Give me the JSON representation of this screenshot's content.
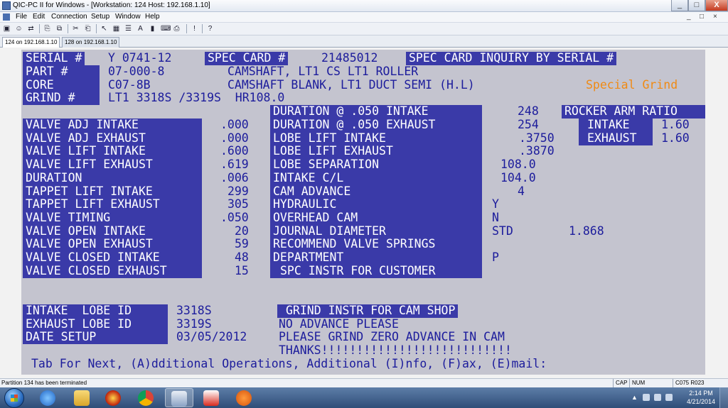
{
  "window": {
    "title": "QIC-PC II for Windows - [Workstation: 124  Host: 192.168.1.10]",
    "min_label": "_",
    "max_label": "□",
    "close_label": "X"
  },
  "menu": {
    "items": [
      "File",
      "Edit",
      "Connection",
      "Setup",
      "Window",
      "Help"
    ],
    "inner_controls": [
      "_",
      "□",
      "×"
    ]
  },
  "toolbar": {
    "buttons": [
      "save-icon",
      "user-icon",
      "connect-icon",
      "copy-icon",
      "paste-icon",
      "cut-icon",
      "select-icon",
      "grid-icon",
      "font-icon",
      "color-icon",
      "print-icon",
      "pause-icon",
      "help-icon"
    ]
  },
  "tabs": [
    {
      "label": "124 on 192.168.1.10",
      "active": true
    },
    {
      "label": "128 on 192.168.1.10",
      "active": false
    }
  ],
  "screen": {
    "serial_label": "SERIAL #",
    "serial_value": "Y 0741-12",
    "spec_card_label": "SPEC CARD #",
    "spec_card_value": "21485012",
    "inquiry_title": "SPEC CARD INQUIRY BY SERIAL #",
    "part_label": "PART #",
    "part_value": "07-000-8",
    "part_desc": "CAMSHAFT, LT1 CS LT1 ROLLER",
    "core_label": "CORE",
    "core_value": "C07-8B",
    "core_desc": "CAMSHAFT BLANK, LT1 DUCT SEMI (H.L)",
    "special": "Special Grind",
    "grind_label": "GRIND #",
    "grind_value": "LT1 3318S /3319S  HR108.0",
    "left_fields": [
      {
        "label": "VALVE ADJ INTAKE",
        "value": ".000"
      },
      {
        "label": "VALVE ADJ EXHAUST",
        "value": ".000"
      },
      {
        "label": "VALVE LIFT INTAKE",
        "value": ".600"
      },
      {
        "label": "VALVE LIFT EXHAUST",
        "value": ".619"
      },
      {
        "label": "DURATION",
        "value": ".006"
      },
      {
        "label": "TAPPET LIFT INTAKE",
        "value": "299"
      },
      {
        "label": "TAPPET LIFT EXHAUST",
        "value": "305"
      },
      {
        "label": "VALVE TIMING",
        "value": ".050"
      },
      {
        "label": "VALVE OPEN INTAKE",
        "value": "20"
      },
      {
        "label": "VALVE OPEN EXHAUST",
        "value": "59"
      },
      {
        "label": "VALVE CLOSED INTAKE",
        "value": "48"
      },
      {
        "label": "VALVE CLOSED EXHAUST",
        "value": "15"
      }
    ],
    "mid_fields": [
      {
        "label": "DURATION @ .050 INTAKE",
        "value": "248"
      },
      {
        "label": "DURATION @ .050 EXHAUST",
        "value": "254"
      },
      {
        "label": "LOBE LIFT INTAKE",
        "value": ".3750"
      },
      {
        "label": "LOBE LIFT EXHAUST",
        "value": ".3870"
      },
      {
        "label": "LOBE SEPARATION",
        "value": "108.0"
      },
      {
        "label": "INTAKE C/L",
        "value": "104.0"
      },
      {
        "label": "CAM ADVANCE",
        "value": "4"
      },
      {
        "label": "HYDRAULIC",
        "value": "Y"
      },
      {
        "label": "OVERHEAD CAM",
        "value": "N"
      },
      {
        "label": "JOURNAL DIAMETER",
        "value": "STD",
        "extra": "1.868"
      },
      {
        "label": "RECOMMEND VALVE SPRINGS",
        "value": ""
      },
      {
        "label": "DEPARTMENT",
        "value": "P"
      },
      {
        "label": "SPC INSTR FOR CUSTOMER",
        "value": ""
      }
    ],
    "rocker_title": "ROCKER ARM RATIO",
    "rocker_intake_label": "INTAKE",
    "rocker_intake_value": "1.60",
    "rocker_exhaust_label": "EXHAUST",
    "rocker_exhaust_value": "1.60",
    "intake_lobe_label": "INTAKE  LOBE ID",
    "intake_lobe_value": "3318S",
    "exhaust_lobe_label": "EXHAUST LOBE ID",
    "exhaust_lobe_value": "3319S",
    "date_setup_label": "DATE SETUP",
    "date_setup_value": "03/05/2012",
    "grind_instr_title": "GRIND INSTR FOR CAM SHOP",
    "grind_instr_lines": [
      "NO ADVANCE PLEASE",
      "PLEASE GRIND ZERO ADVANCE IN CAM",
      "THANKS!!!!!!!!!!!!!!!!!!!!!!!!!!!"
    ],
    "prompt": "Tab For Next, (A)dditional Operations, Additional (I)nfo, (F)ax, (E)mail:"
  },
  "status": {
    "message": "Partition 134 has been terminated",
    "caps": "CAP",
    "num": "NUM",
    "cursor": "C075  R023"
  },
  "taskbar": {
    "apps": [
      "explorer-icon",
      "internet-explorer-icon",
      "file-explorer-icon",
      "ball-app-icon",
      "chrome-icon",
      "mail-app-icon",
      "game-icon",
      "s-app-icon"
    ],
    "time": "2:14 PM",
    "date": "4/21/2014"
  }
}
